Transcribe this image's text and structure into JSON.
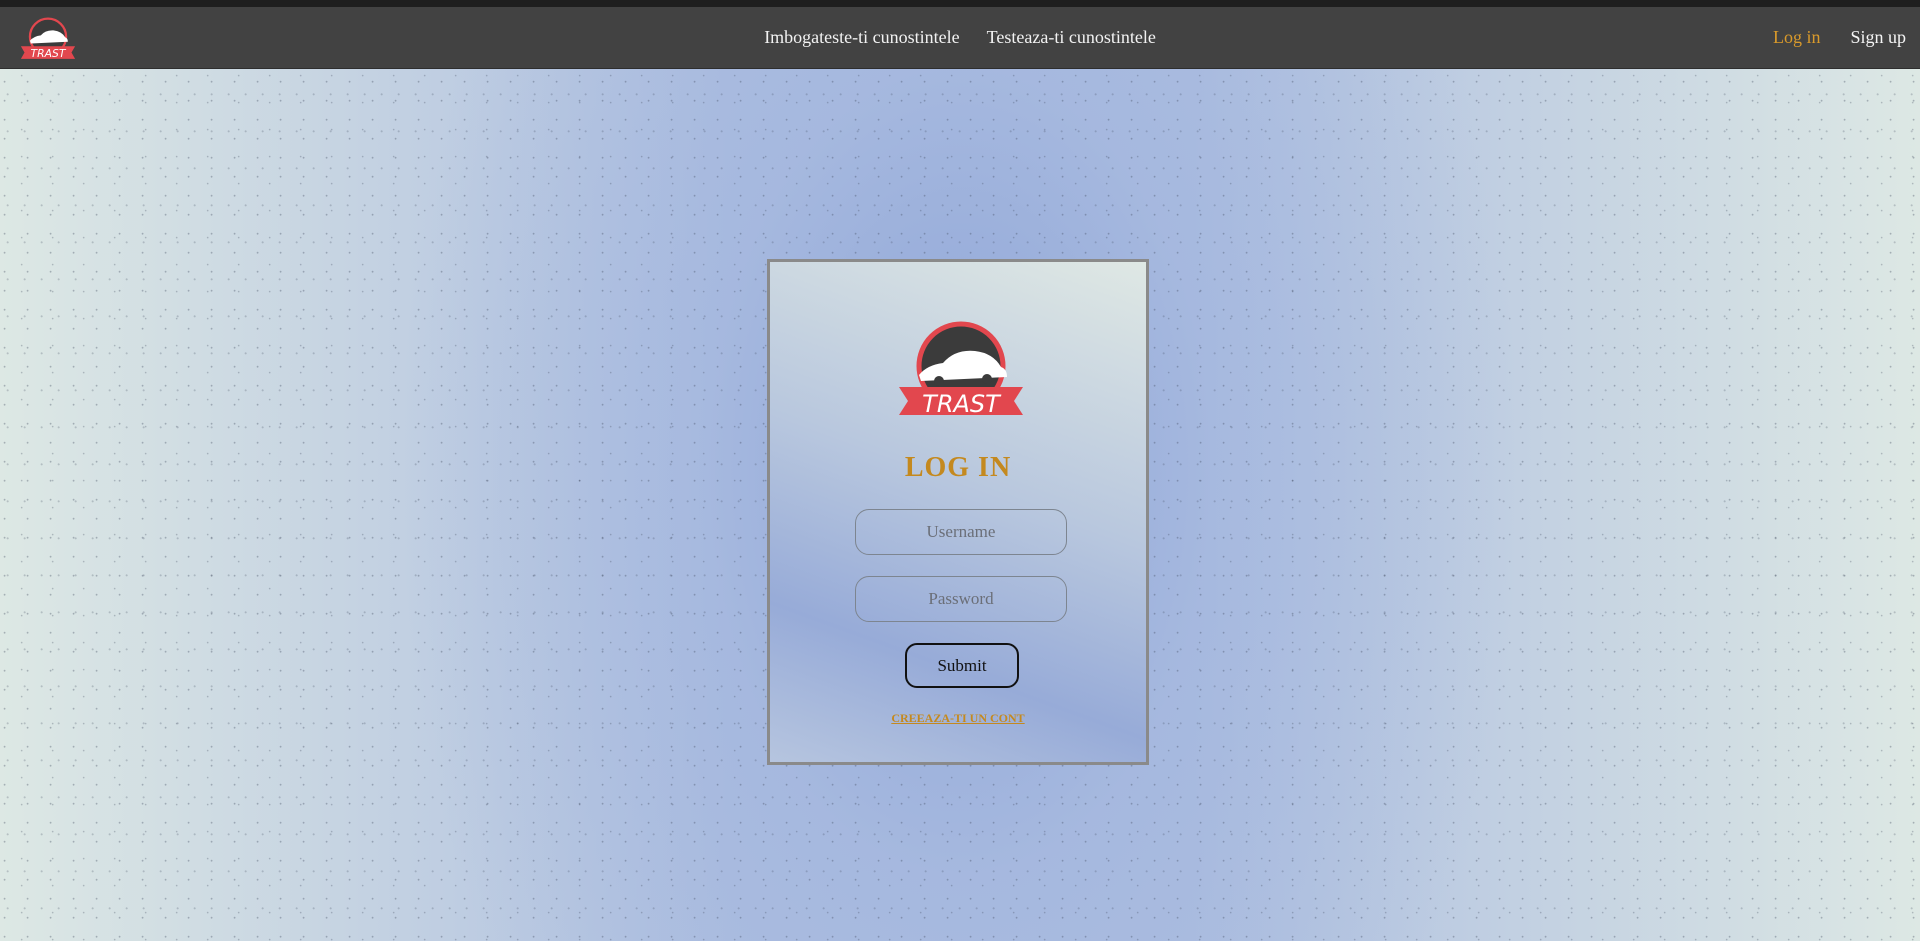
{
  "navbar": {
    "logo_text": "TRAST",
    "links": [
      {
        "label": "Imbogateste-ti cunostintele"
      },
      {
        "label": "Testeaza-ti cunostintele"
      }
    ],
    "login_label": "Log in",
    "signup_label": "Sign up"
  },
  "login_card": {
    "logo_text": "TRAST",
    "title": "LOG IN",
    "username_placeholder": "Username",
    "password_placeholder": "Password",
    "submit_label": "Submit",
    "create_account_label": "CREEAZA-TI UN CONT"
  },
  "colors": {
    "navbar_bg": "#424242",
    "accent": "#c4891f",
    "logo_red": "#e2474e",
    "logo_dark": "#3b3b3b"
  }
}
